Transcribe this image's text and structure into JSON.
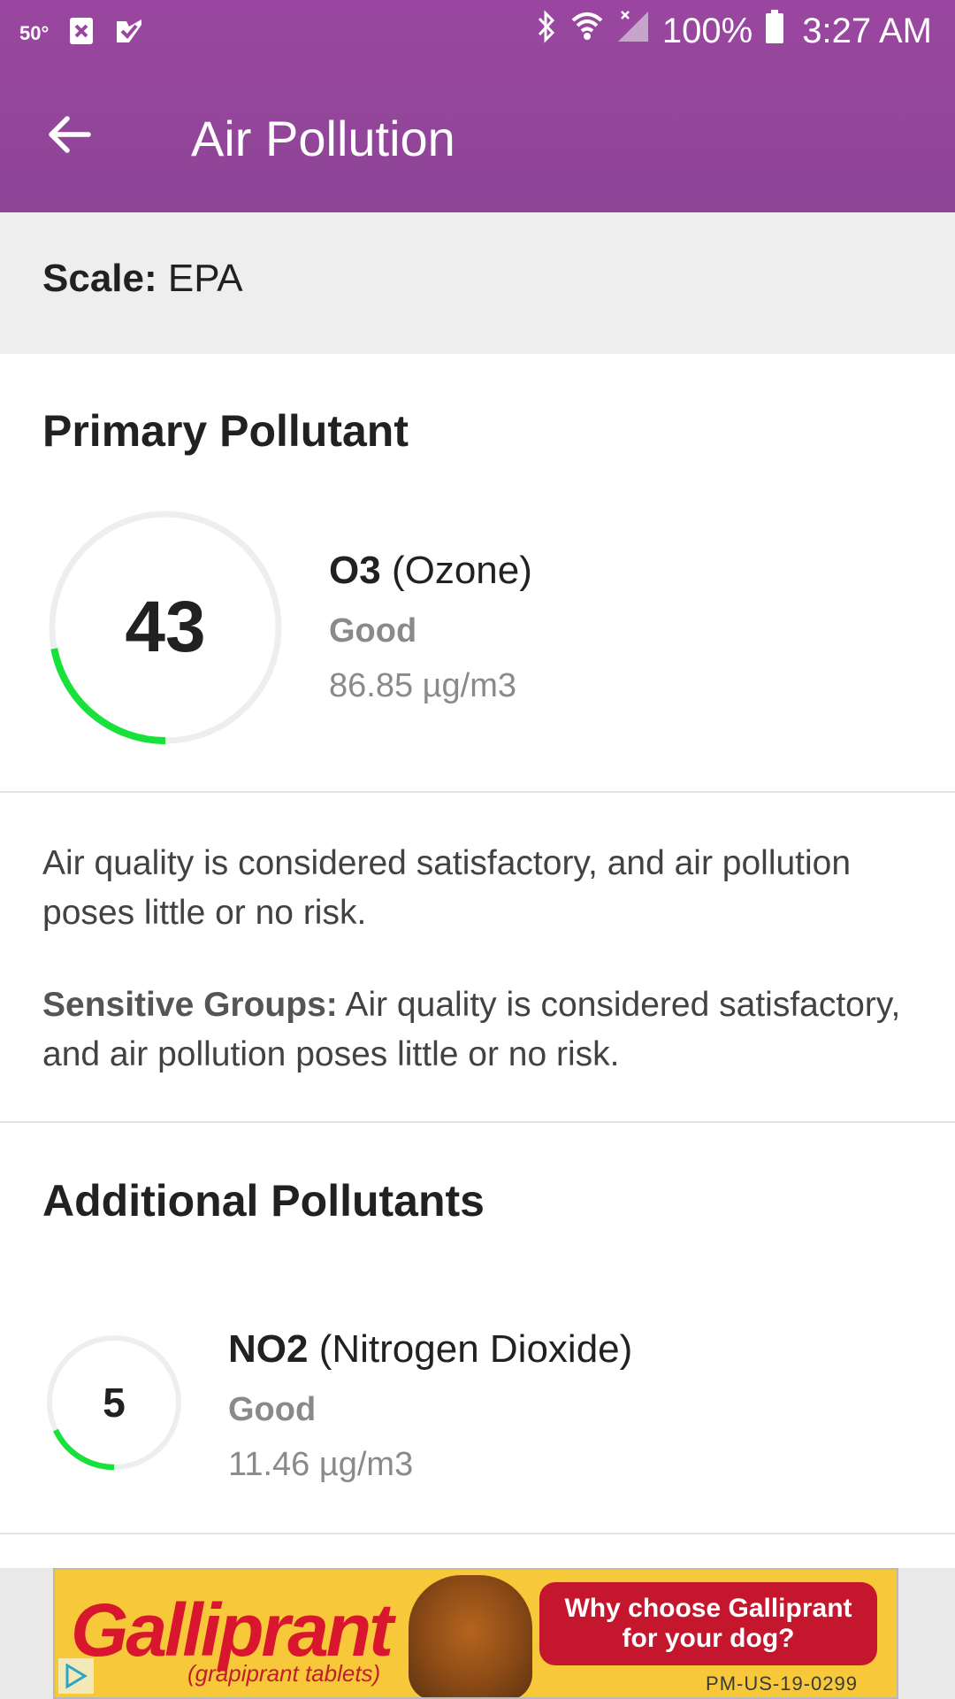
{
  "status_bar": {
    "temperature": "50°",
    "battery": "100%",
    "time": "3:27 AM"
  },
  "app_bar": {
    "title": "Air Pollution"
  },
  "scale": {
    "label": "Scale:",
    "value": "EPA"
  },
  "primary": {
    "heading": "Primary Pollutant",
    "aqi": "43",
    "aqi_fraction": 0.22,
    "code": "O3",
    "name": "(Ozone)",
    "status": "Good",
    "concentration": "86.85 µg/m3",
    "color": "#18e13b"
  },
  "description": {
    "general": "Air quality is considered satisfactory, and air pollution poses little or no risk.",
    "sensitive_label": "Sensitive Groups:",
    "sensitive_text": " Air quality is considered satisfactory, and air pollution poses little or no risk."
  },
  "additional": {
    "heading": "Additional Pollutants",
    "items": [
      {
        "aqi": "5",
        "aqi_fraction": 0.18,
        "code": "NO2",
        "name": "(Nitrogen Dioxide)",
        "status": "Good",
        "concentration": "11.46 µg/m3",
        "color": "#18e13b"
      }
    ]
  },
  "ad": {
    "brand": "Galliprant",
    "subtitle": "(grapiprant tablets)",
    "cta": "Why choose Galliprant for your dog?",
    "code": "PM-US-19-0299"
  }
}
